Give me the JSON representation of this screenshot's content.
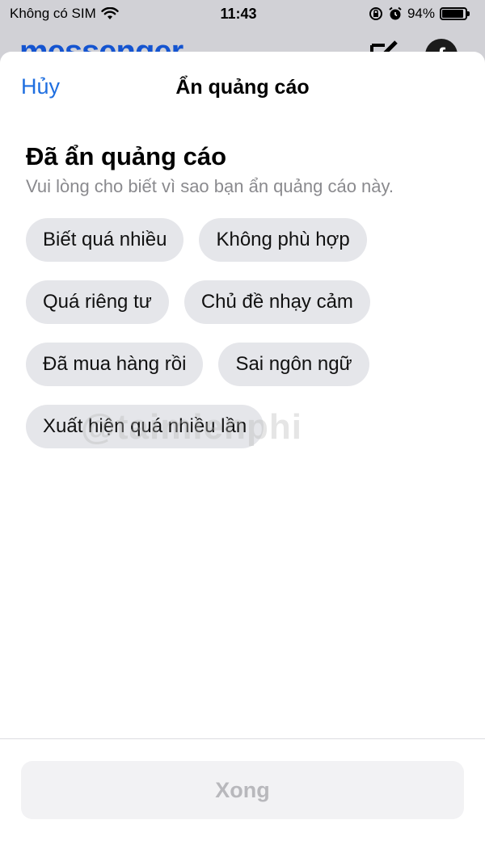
{
  "status_bar": {
    "carrier": "Không có SIM",
    "time": "11:43",
    "battery_percent_label": "94%",
    "battery_level": 0.94
  },
  "background_app": {
    "logo_text": "messenger"
  },
  "sheet": {
    "cancel_label": "Hủy",
    "title": "Ẩn quảng cáo",
    "heading": "Đã ẩn quảng cáo",
    "subtext": "Vui lòng cho biết vì sao bạn ẩn quảng cáo này.",
    "reasons": [
      "Biết quá nhiều",
      "Không phù hợp",
      "Quá riêng tư",
      "Chủ đề nhạy cảm",
      "Đã mua hàng rồi",
      "Sai ngôn ngữ",
      "Xuất hiện quá nhiều lần"
    ],
    "done_label": "Xong"
  },
  "watermark": "@taimienphi",
  "colors": {
    "accent": "#1f6fe0",
    "chip_bg": "#e5e6ea",
    "disabled_text": "#b8b8bc"
  }
}
